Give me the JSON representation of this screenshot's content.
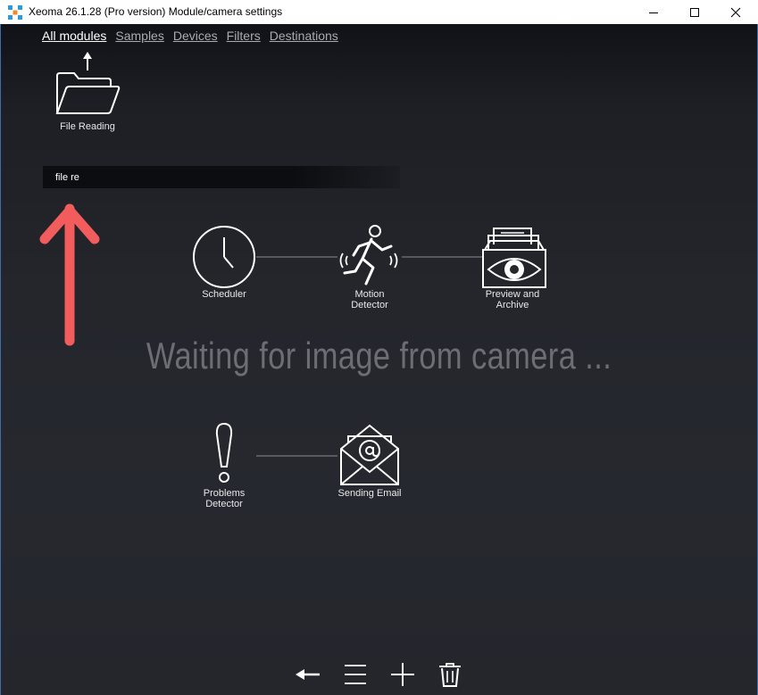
{
  "window": {
    "title": "Xeoma 26.1.28 (Pro version) Module/camera settings"
  },
  "tabs": [
    {
      "label": "All modules",
      "active": true
    },
    {
      "label": "Samples",
      "active": false
    },
    {
      "label": "Devices",
      "active": false
    },
    {
      "label": "Filters",
      "active": false
    },
    {
      "label": "Destinations",
      "active": false
    }
  ],
  "search_result": {
    "label": "File Reading",
    "icon": "folder-upload-icon"
  },
  "search": {
    "value": "file re"
  },
  "modules": {
    "scheduler": {
      "label": "Scheduler",
      "icon": "clock-icon"
    },
    "motion_detector": {
      "label": "Motion\nDetector",
      "icon": "running-person-icon"
    },
    "preview_archive": {
      "label": "Preview and\nArchive",
      "icon": "archive-eye-icon"
    },
    "problems_detector": {
      "label": "Problems\nDetector",
      "icon": "exclamation-icon"
    },
    "sending_email": {
      "label": "Sending Email",
      "icon": "email-at-icon"
    }
  },
  "status": {
    "waiting": "Waiting for image from camera ..."
  },
  "bottom_toolbar": {
    "back": "back-arrow-icon",
    "menu": "menu-icon",
    "add": "plus-icon",
    "delete": "trash-icon"
  },
  "colors": {
    "annotation_arrow": "#f25c5c",
    "background": "#24262c",
    "waiting_text": "#6c6e74"
  }
}
